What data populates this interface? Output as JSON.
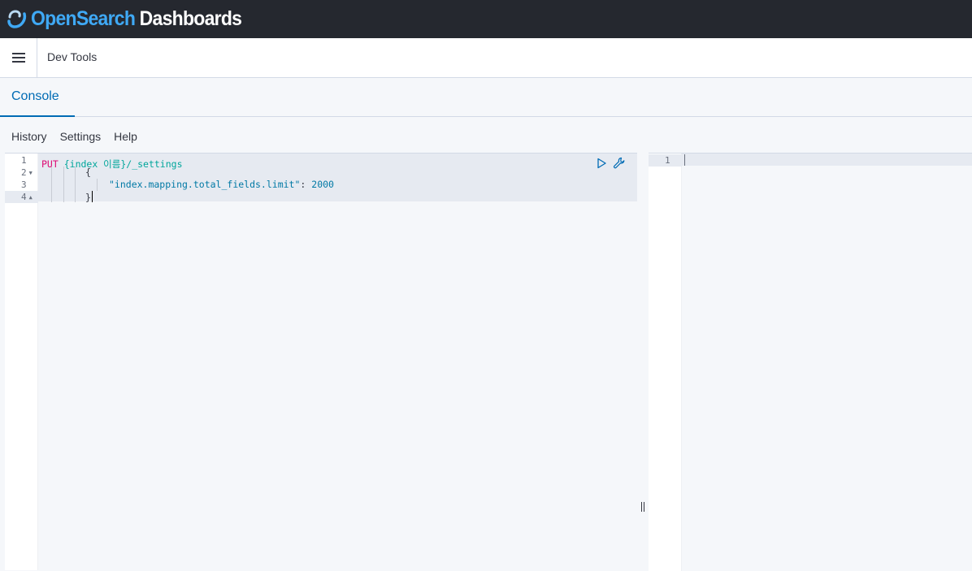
{
  "brand": {
    "part1": "Open",
    "part2": "Search",
    "part3": "Dashboards"
  },
  "header": {
    "breadcrumb": "Dev Tools"
  },
  "tabs": [
    {
      "label": "Console"
    }
  ],
  "topmenu": {
    "history": "History",
    "settings": "Settings",
    "help": "Help"
  },
  "editor": {
    "line_numbers": [
      "1",
      "2",
      "3",
      "4"
    ],
    "lines": {
      "l1_method": "PUT",
      "l1_url": "{index 이름}/_settings",
      "l2_open": "{",
      "l3_key": "\"index.mapping.total_fields.limit\"",
      "l3_colon": ": ",
      "l3_value": "2000",
      "l4_close": "}"
    }
  },
  "output": {
    "line_numbers": [
      "1"
    ]
  },
  "icons": {
    "run": "play-icon",
    "wrench": "wrench-icon",
    "menu": "hamburger-icon"
  },
  "colors": {
    "accent": "#006bb4",
    "brand_blue": "#3fa9f5",
    "topbar_bg": "#25282f",
    "method": "#dd0a73",
    "url": "#00a69b"
  }
}
